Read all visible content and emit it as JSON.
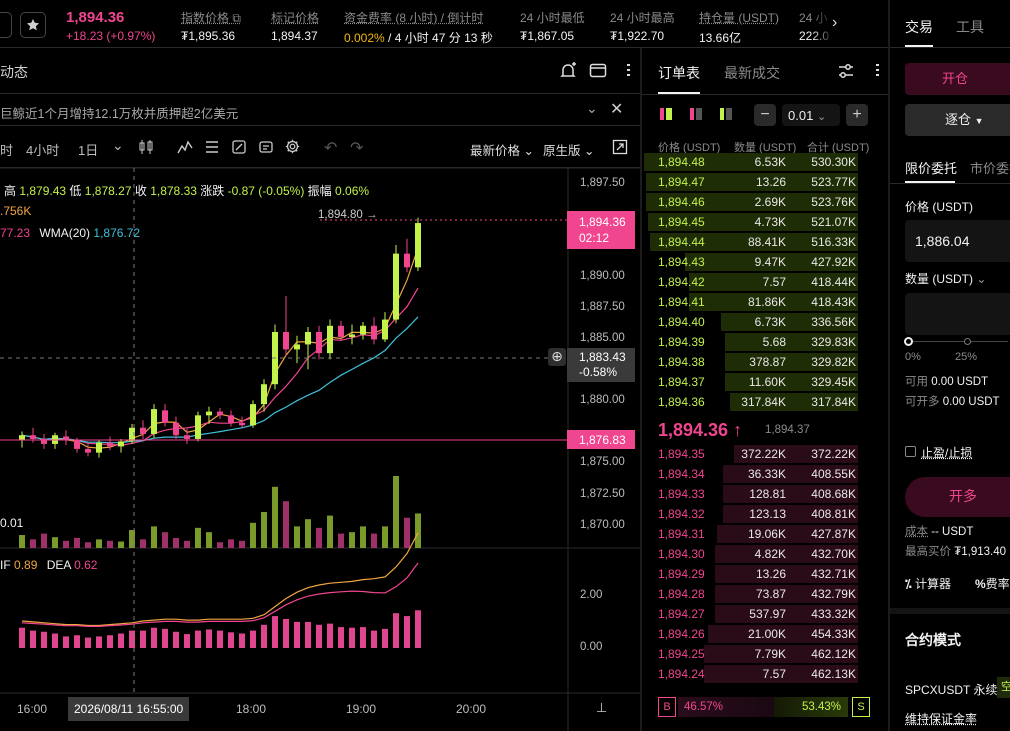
{
  "colors": {
    "up": "#c3f24a",
    "down": "#f0458f",
    "accent": "#f0b90b",
    "bg": "#000000",
    "panel": "#141414",
    "line": "#2a2a2a"
  },
  "ticker": {
    "last": "1,894.36",
    "change": "+18.23 (+0.97%)",
    "stats": [
      {
        "label": "指数价格",
        "value": "₮1,895.36"
      },
      {
        "label": "标记价格",
        "value": "1,894.37"
      },
      {
        "label": "资金费率 (8 小时) / 倒计时",
        "value_a": "0.002%",
        "value_b": " / 4 小时 47 分 13 秒"
      },
      {
        "label": "24 小时最低",
        "value": "₮1,867.05"
      },
      {
        "label": "24 小时最高",
        "value": "₮1,922.70"
      },
      {
        "label": "持仓量 (USDT)",
        "value": "13.66亿"
      },
      {
        "label": "24 小",
        "value": "222.0"
      }
    ]
  },
  "chart_panel": {
    "tab": "动态",
    "news": "巨鲸近1个月增持12.1万枚并质押超2亿美元",
    "intervals": [
      "时",
      "4小时",
      "1日"
    ],
    "price_type": "最新价格",
    "version": "原生版",
    "ohlc": {
      "high_label": "高",
      "high": "1,879.43",
      "low_label": "低",
      "low": "1,878.27",
      "close_label": "收",
      "close": "1,878.33",
      "chg_label": "涨跌",
      "chg": "-0.87 (-0.05%)",
      "amp_label": "振幅",
      "amp": "0.06%"
    },
    "vol_label": ".756K",
    "ma_left": "77.23",
    "wma_label": "WMA(20)",
    "wma_value": "1,876.72",
    "vol_pane_value": "0.01",
    "macd": {
      "dif_label": "IF",
      "dif": "0.89",
      "dea_label": "DEA",
      "dea": "0.62"
    },
    "peak_label": "1,894.80"
  },
  "price_axis": [
    "1,897.50",
    "1,890.00",
    "1,887.50",
    "1,885.00",
    "1,880.00",
    "1,875.00",
    "1,872.50",
    "1,870.00"
  ],
  "macd_axis": [
    "2.00",
    "0.00"
  ],
  "last_price_tag": {
    "price": "1,894.36",
    "countdown": "02:12"
  },
  "crosshair_tag": {
    "price": "1,883.43",
    "pct": "-0.58%"
  },
  "low_tag": "1,876.83",
  "time_axis": [
    "16:00",
    "18:00",
    "19:00",
    "20:00"
  ],
  "crosshair_time": "2026/08/11 16:55:00",
  "orderbook": {
    "tabs": [
      "订单表",
      "最新成交"
    ],
    "tick": "0.01",
    "headers": [
      "价格 (USDT)",
      "数量 (USDT)",
      "合计 (USDT)"
    ],
    "asks": [
      {
        "p": "1,894.48",
        "q": "6.53K",
        "t": "530.30K",
        "d": 100
      },
      {
        "p": "1,894.47",
        "q": "13.26",
        "t": "523.77K",
        "d": 99
      },
      {
        "p": "1,894.46",
        "q": "2.69K",
        "t": "523.76K",
        "d": 99
      },
      {
        "p": "1,894.45",
        "q": "4.73K",
        "t": "521.07K",
        "d": 98
      },
      {
        "p": "1,894.44",
        "q": "88.41K",
        "t": "516.33K",
        "d": 97
      },
      {
        "p": "1,894.43",
        "q": "9.47K",
        "t": "427.92K",
        "d": 81
      },
      {
        "p": "1,894.42",
        "q": "7.57",
        "t": "418.44K",
        "d": 79
      },
      {
        "p": "1,894.41",
        "q": "81.86K",
        "t": "418.43K",
        "d": 79
      },
      {
        "p": "1,894.40",
        "q": "6.73K",
        "t": "336.56K",
        "d": 64
      },
      {
        "p": "1,894.39",
        "q": "5.68",
        "t": "329.83K",
        "d": 62
      },
      {
        "p": "1,894.38",
        "q": "378.87",
        "t": "329.82K",
        "d": 62
      },
      {
        "p": "1,894.37",
        "q": "11.60K",
        "t": "329.45K",
        "d": 62
      },
      {
        "p": "1,894.36",
        "q": "317.84K",
        "t": "317.84K",
        "d": 60
      }
    ],
    "mid": {
      "price": "1,894.36",
      "arrow": "↑",
      "mark": "1,894.37"
    },
    "bids": [
      {
        "p": "1,894.35",
        "q": "372.22K",
        "t": "372.22K",
        "d": 58
      },
      {
        "p": "1,894.34",
        "q": "36.33K",
        "t": "408.55K",
        "d": 63
      },
      {
        "p": "1,894.33",
        "q": "128.81",
        "t": "408.68K",
        "d": 63
      },
      {
        "p": "1,894.32",
        "q": "123.13",
        "t": "408.81K",
        "d": 63
      },
      {
        "p": "1,894.31",
        "q": "19.06K",
        "t": "427.87K",
        "d": 66
      },
      {
        "p": "1,894.30",
        "q": "4.82K",
        "t": "432.70K",
        "d": 67
      },
      {
        "p": "1,894.29",
        "q": "13.26",
        "t": "432.71K",
        "d": 67
      },
      {
        "p": "1,894.28",
        "q": "73.87",
        "t": "432.79K",
        "d": 67
      },
      {
        "p": "1,894.27",
        "q": "537.97",
        "t": "433.32K",
        "d": 67
      },
      {
        "p": "1,894.26",
        "q": "21.00K",
        "t": "454.33K",
        "d": 70
      },
      {
        "p": "1,894.25",
        "q": "7.79K",
        "t": "462.12K",
        "d": 72
      },
      {
        "p": "1,894.24",
        "q": "7.57",
        "t": "462.13K",
        "d": 72
      }
    ],
    "ratio": {
      "b_label": "B",
      "b": "46.57%",
      "s": "53.43%",
      "s_label": "S"
    }
  },
  "trade": {
    "tabs": [
      "交易",
      "工具"
    ],
    "open_btn": "开仓",
    "margin_mode": "逐仓",
    "order_tabs": [
      "限价委托",
      "市价委托"
    ],
    "price_label": "价格 (USDT)",
    "price_value": "1,886.04",
    "qty_label": "数量 (USDT)",
    "slider": [
      "0%",
      "25%"
    ],
    "avail_label": "可用",
    "avail": "0.00 USDT",
    "max_open_label": "可开多",
    "max_open": "0.00 USDT",
    "tpsl": "止盈/止损",
    "long_btn": "开多",
    "cost_label": "成本",
    "cost": "-- USDT",
    "max_buy_label": "最高买价",
    "max_buy": "₮1,913.40",
    "calc": "计算器",
    "fee": "费率",
    "contract_title": "合约模式",
    "symbol": "SPCXUSDT 永续",
    "symbol_tag": "空",
    "mm": "维持保证金率"
  }
}
